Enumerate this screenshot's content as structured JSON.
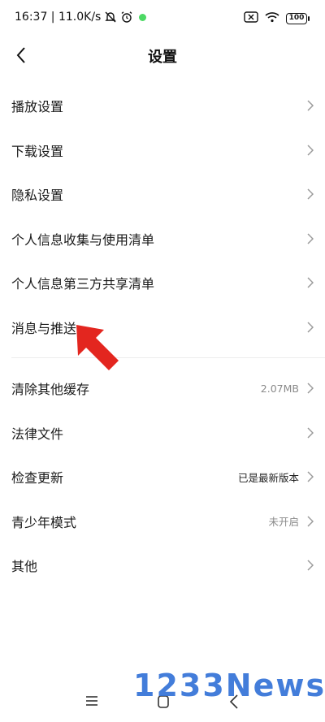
{
  "status_bar": {
    "time_speed": "16:37 | 11.0K/s",
    "battery": "100"
  },
  "header": {
    "title": "设置"
  },
  "settings": {
    "group1": [
      {
        "label": "播放设置"
      },
      {
        "label": "下载设置"
      },
      {
        "label": "隐私设置"
      },
      {
        "label": "个人信息收集与使用清单"
      },
      {
        "label": "个人信息第三方共享清单"
      },
      {
        "label": "消息与推送"
      }
    ],
    "group2": [
      {
        "label": "清除其他缓存",
        "value": "2.07MB"
      },
      {
        "label": "法律文件"
      },
      {
        "label": "检查更新",
        "value": "已是最新版本"
      },
      {
        "label": "青少年模式",
        "value": "未开启"
      },
      {
        "label": "其他"
      }
    ]
  },
  "watermark": "1233News",
  "colors": {
    "accent_arrow": "#e3261f",
    "watermark": "#2f6fd6"
  }
}
